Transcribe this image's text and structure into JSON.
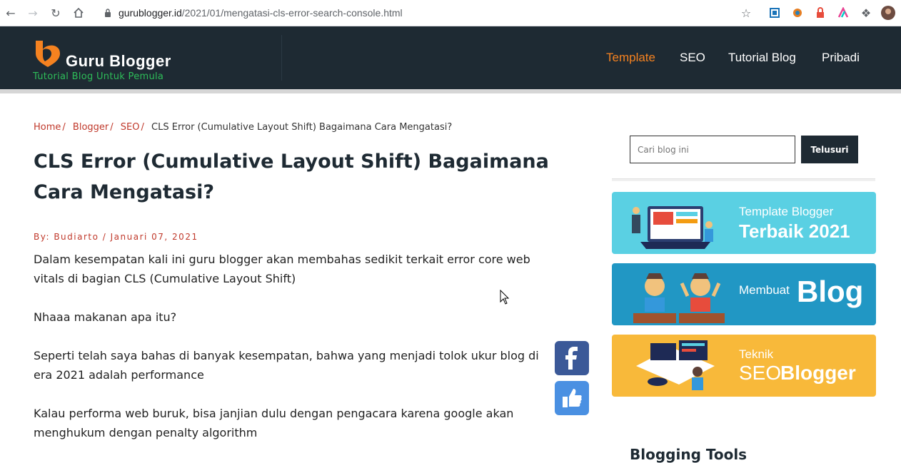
{
  "browser": {
    "url_domain": "gurublogger.id",
    "url_path": "/2021/01/mengatasi-cls-error-search-console.html"
  },
  "site": {
    "brand": "Guru Blogger",
    "tagline": "Tutorial Blog Untuk Pemula",
    "nav": [
      {
        "label": "Template",
        "active": true
      },
      {
        "label": "SEO",
        "active": false
      },
      {
        "label": "Tutorial Blog",
        "active": false
      },
      {
        "label": "Pribadi",
        "active": false
      }
    ],
    "colors": {
      "header": "#1e2a33",
      "accent": "#f58220",
      "tagline": "#2ebd59",
      "link": "#c0392b"
    }
  },
  "breadcrumb": {
    "items": [
      "Home",
      "Blogger",
      "SEO"
    ],
    "current": "CLS Error (Cumulative Layout Shift) Bagaimana Cara Mengatasi?"
  },
  "post": {
    "title": "CLS Error (Cumulative Layout Shift) Bagaimana Cara Mengatasi?",
    "byline": "By: Budiarto / Januari 07, 2021",
    "paragraphs": [
      "Dalam kesempatan kali ini guru blogger akan membahas sedikit terkait error core web vitals di bagian CLS (Cumulative Layout Shift)",
      "Nhaaa makanan apa itu?",
      "Seperti telah saya bahas di banyak kesempatan, bahwa yang menjadi tolok ukur blog di era 2021 adalah performance",
      "Kalau performa web buruk, bisa janjian dulu dengan pengacara karena google akan menghukum dengan penalty algorithm"
    ]
  },
  "sidebar": {
    "search_placeholder": "Cari blog ini",
    "search_button": "Telusuri",
    "banners": [
      {
        "line1": "Template Blogger",
        "line2": "Terbaik 2021",
        "color": "#5ad0e3"
      },
      {
        "line1": "Membuat",
        "line2": "Blog",
        "color": "#2197c4"
      },
      {
        "line1": "Teknik",
        "line2a": "SEO",
        "line2b": "Blogger",
        "color": "#f8b93a"
      }
    ],
    "heading": "Blogging Tools"
  }
}
